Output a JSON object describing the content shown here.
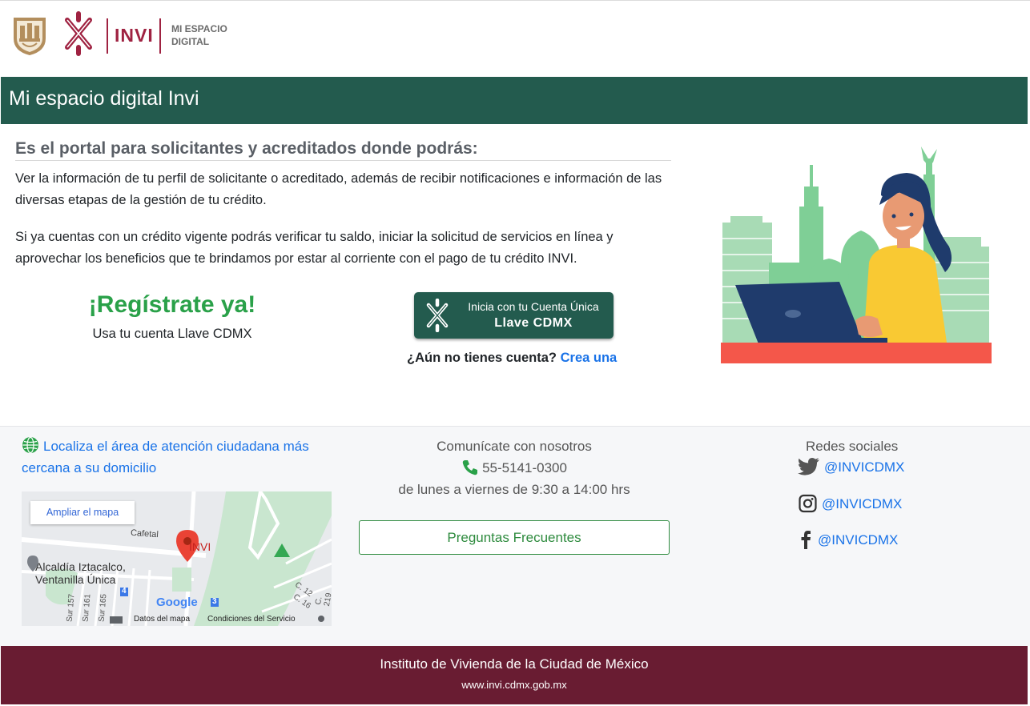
{
  "header": {
    "brand": "INVI",
    "subtitle_line1": "MI ESPACIO",
    "subtitle_line2": "DIGITAL"
  },
  "banner": {
    "title": "Mi espacio digital Invi"
  },
  "main": {
    "heading": "Es el portal para solicitantes y acreditados donde podrás:",
    "paragraph1": "Ver la información de tu perfil de solicitante o acreditado, además de recibir notificaciones e información de las diversas etapas de la gestión de tu crédito.",
    "paragraph2": "Si ya cuentas con un crédito vigente podrás verificar tu saldo, iniciar la solicitud de servicios en línea y aprovechar los beneficios que te brindamos por estar al corriente con el pago de tu crédito INVI.",
    "register_title": "¡Regístrate ya!",
    "register_subtitle": "Usa tu cuenta Llave CDMX",
    "llave_button_line1": "Inicia con tu Cuenta Única",
    "llave_button_line2": "Llave CDMX",
    "no_account_text": "¿Aún no tienes cuenta?",
    "create_account_link": "Crea una"
  },
  "info": {
    "localiza_link": "Localiza el área de atención ciudadana más cercana a su domicilio",
    "map": {
      "enlarge_button": "Ampliar el mapa",
      "place_label": "INVI",
      "street_cafetal": "Cafetal",
      "alcaldia_line1": "Alcaldía Iztacalco,",
      "alcaldia_line2": "Ventanilla Única",
      "badge_4": "4",
      "badge_3": "3",
      "street_c12": "C. 12",
      "street_c16": "C. 16",
      "street_c219": "C. 219",
      "street_sur157": "Sur 157",
      "street_sur161": "Sur 161",
      "street_sur165": "Sur 165",
      "google_logo": "Google",
      "map_data_link": "Datos del mapa",
      "terms_link": "Condiciones del Servicio"
    },
    "contact": {
      "title": "Comunícate con nosotros",
      "phone": "55-5141-0300",
      "hours": "de lunes a viernes de 9:30 a 14:00 hrs"
    },
    "faq_button": "Preguntas Frecuentes",
    "social": {
      "title": "Redes sociales",
      "twitter": "@INVICDMX",
      "instagram": "@INVICDMX",
      "facebook": "@INVICDMX"
    }
  },
  "footer": {
    "name": "Instituto de Vivienda de la Ciudad de México",
    "url": "www.invi.cdmx.gob.mx"
  },
  "colors": {
    "banner_green": "#235b4e",
    "brand_maroon": "#9f2241",
    "footer_maroon": "#691c32",
    "register_green": "#2aa149",
    "link_blue": "#1a73e8",
    "illustration_red": "#f4574a"
  }
}
